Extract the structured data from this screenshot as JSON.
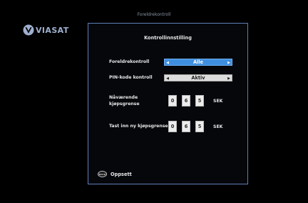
{
  "header": {
    "title": "Foreldrekontroll",
    "logo_text": "VIASAT"
  },
  "panel": {
    "title": "Kontrollinnstilling",
    "rows": [
      {
        "label": "Foreldrekontroll",
        "value": "Alle",
        "state": "focused"
      },
      {
        "label": "PIN-kode kontroll",
        "value": "Aktiv",
        "state": "normal"
      }
    ],
    "current_limit": {
      "label_line1": "Nåværende",
      "label_line2": "kjøpsgrense",
      "digits": [
        "0",
        "6",
        "5"
      ],
      "unit": "SEK"
    },
    "new_limit": {
      "label": "Tast inn ny kjøpsgrense",
      "digits": [
        "0",
        "6",
        "5"
      ],
      "unit": "SEK"
    }
  },
  "footer": {
    "back_button_label": "BACK",
    "back_action_label": "Oppsett"
  },
  "colors": {
    "background": "#000000",
    "panel_border": "#5e7fb8",
    "focus_blue": "#3f8fe0",
    "text": "#e6e6e6"
  },
  "icons": {
    "logo": "viasat-logo-icon",
    "arrow_left": "arrow-left-icon",
    "arrow_right": "arrow-right-icon",
    "back_key": "back-key-icon"
  }
}
